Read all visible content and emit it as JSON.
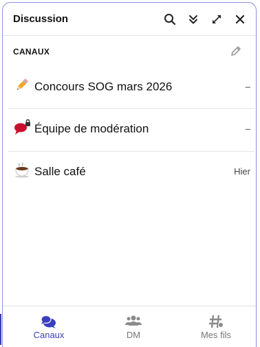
{
  "header": {
    "title": "Discussion",
    "icons": [
      "search-icon",
      "collapse-icon",
      "expand-icon",
      "close-icon"
    ]
  },
  "section": {
    "title": "CANAUX",
    "edit_icon": "pencil-icon"
  },
  "channels": [
    {
      "emoji": "pencil",
      "name": "Concours SOG mars 2026",
      "time": "–"
    },
    {
      "emoji": "speech-bubble-lock",
      "name": "Équipe de modération",
      "time": "–"
    },
    {
      "emoji": "coffee",
      "name": "Salle café",
      "time": "Hier"
    }
  ],
  "nav": {
    "items": [
      {
        "label": "Canaux",
        "icon": "chat-bubbles-icon",
        "active": true
      },
      {
        "label": "DM",
        "icon": "people-icon",
        "active": false
      },
      {
        "label": "Mes fils",
        "icon": "hashtag-icon",
        "active": false
      }
    ]
  },
  "colors": {
    "accent": "#3b3fc0",
    "border": "#8b90e0"
  }
}
